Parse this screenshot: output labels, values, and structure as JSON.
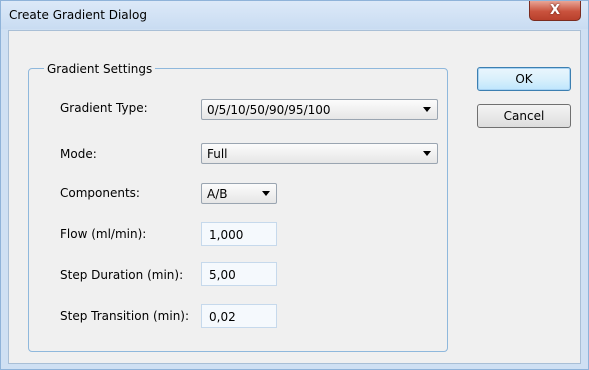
{
  "window": {
    "title": "Create Gradient Dialog",
    "close_label": "X"
  },
  "group": {
    "legend": "Gradient Settings"
  },
  "fields": {
    "gradient_type": {
      "label": "Gradient Type:",
      "value": "0/5/10/50/90/95/100"
    },
    "mode": {
      "label": "Mode:",
      "value": "Full"
    },
    "components": {
      "label": "Components:",
      "value": "A/B"
    },
    "flow": {
      "label": "Flow (ml/min):",
      "value": "1,000"
    },
    "step_duration": {
      "label": "Step Duration (min):",
      "value": "5,00"
    },
    "step_transition": {
      "label": "Step Transition (min):",
      "value": "0,02"
    }
  },
  "buttons": {
    "ok": "OK",
    "cancel": "Cancel"
  }
}
